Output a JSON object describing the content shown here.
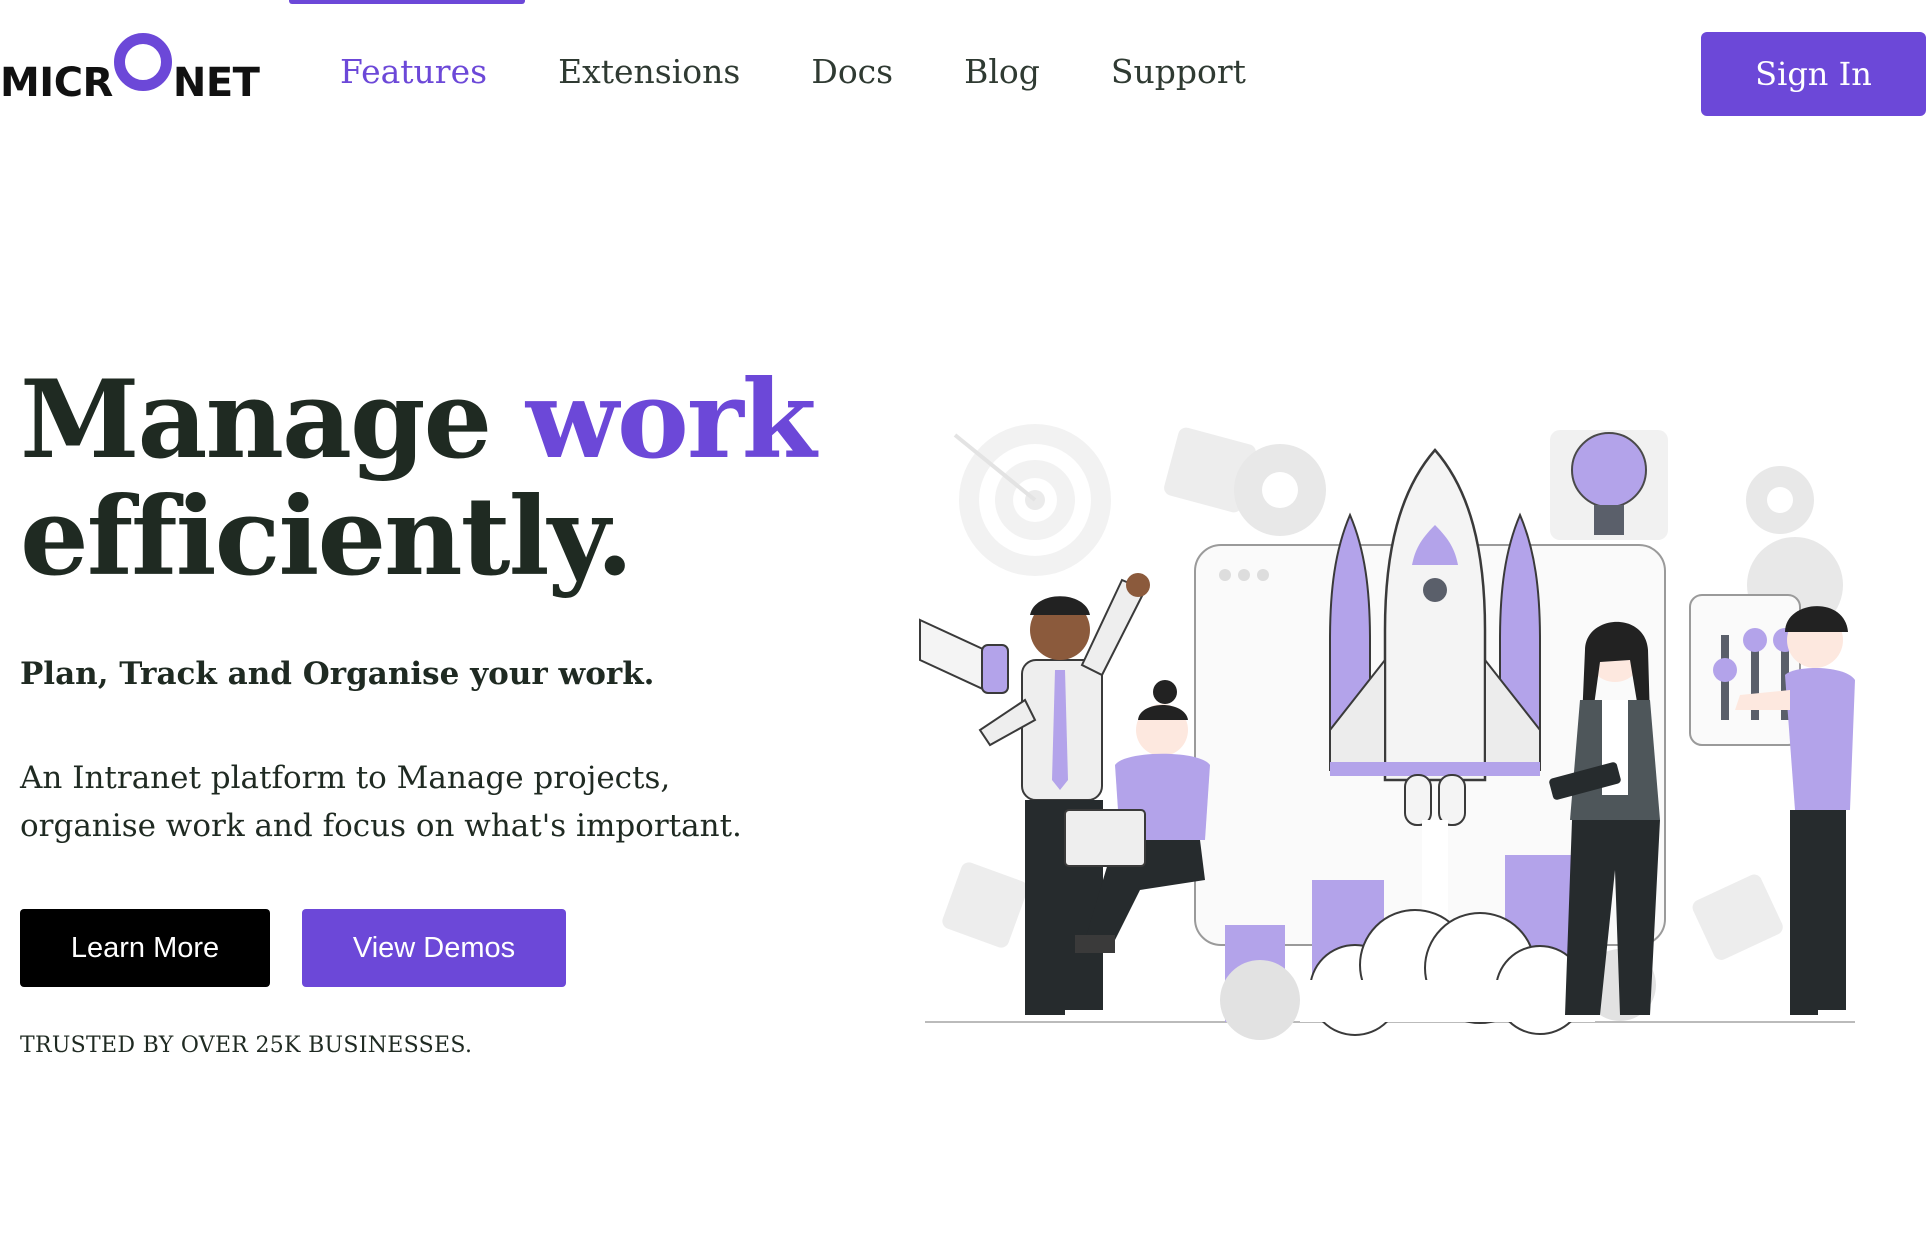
{
  "brand": {
    "logo_left": "MICR",
    "logo_right": "NET",
    "accent_color": "#6c48d8",
    "dark_color": "#1f2a22"
  },
  "nav": {
    "items": [
      {
        "label": "Features",
        "active": true
      },
      {
        "label": "Extensions",
        "active": false
      },
      {
        "label": "Docs",
        "active": false
      },
      {
        "label": "Blog",
        "active": false
      },
      {
        "label": "Support",
        "active": false
      }
    ],
    "signin_label": "Sign In"
  },
  "hero": {
    "headline_part1": "Manage ",
    "headline_accent": "work",
    "headline_part2": "efficiently.",
    "tagline": "Plan, Track and Organise your work.",
    "description": "An Intranet platform to Manage projects, organise work and focus on what's important.",
    "learn_more_label": "Learn More",
    "view_demos_label": "View Demos",
    "trusted_text": "TRUSTED BY OVER 25K BUSINESSES."
  },
  "illustration": {
    "icons": [
      "target-icon",
      "puzzle-icon",
      "gear-icon",
      "rocket-icon",
      "lightbulb-icon",
      "megaphone-icon",
      "laptop-icon",
      "tablet-icon",
      "slider-panel-icon"
    ]
  }
}
